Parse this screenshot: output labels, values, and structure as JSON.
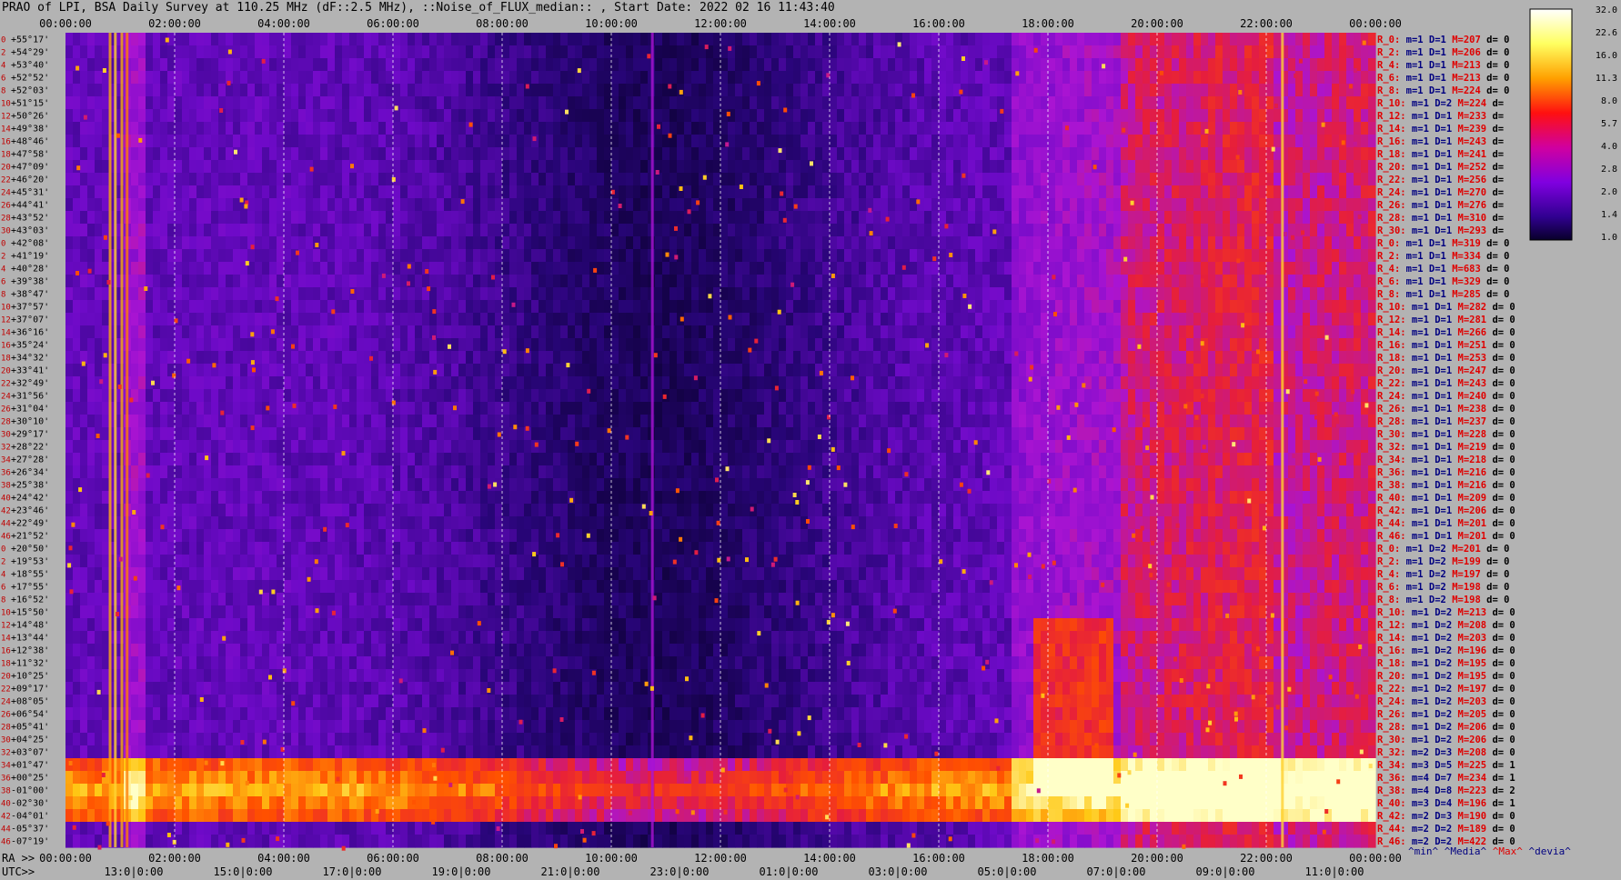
{
  "title": "PRAO of LPI, BSA Daily Survey at 110.25 MHz (dF::2.5 MHz), ::Noise_of_FLUX_median:: , Start Date: 2022 02 16 11:43:40",
  "bottom_labels": {
    "ra": "RA >>",
    "utc": "UTC>>"
  },
  "chart_data": {
    "type": "heatmap",
    "title": "PRAO of LPI, BSA Daily Survey at 110.25 MHz (dF::2.5 MHz), ::Noise_of_FLUX_median:: , Start Date: 2022 02 16 11:43:40",
    "top_axis_ticks": [
      "00:00:00",
      "02:00:00",
      "04:00:00",
      "06:00:00",
      "08:00:00",
      "10:00:00",
      "12:00:00",
      "14:00:00",
      "16:00:00",
      "18:00:00",
      "20:00:00",
      "22:00:00",
      "00:00:00"
    ],
    "ra_axis_ticks": [
      "00:00:00",
      "02:00:00",
      "04:00:00",
      "06:00:00",
      "08:00:00",
      "10:00:00",
      "12:00:00",
      "14:00:00",
      "16:00:00",
      "18:00:00",
      "20:00:00",
      "22:00:00",
      "00:00:00"
    ],
    "utc_axis_ticks": [
      "13:0|0:00",
      "15:0|0:00",
      "17:0|0:00",
      "19:0|0:00",
      "21:0|0:00",
      "23:0|0:00",
      "01:0|0:00",
      "03:0|0:00",
      "05:0|0:00",
      "07:0|0:00",
      "09:0|0:00",
      "11:0|0:00"
    ],
    "dec_labels": [
      "+55°17'",
      "+54°29'",
      "+53°40'",
      "+52°52'",
      "+52°03'",
      "+51°15'",
      "+50°26'",
      "+49°38'",
      "+48°46'",
      "+47°58'",
      "+47°09'",
      "+46°20'",
      "+45°31'",
      "+44°41'",
      "+43°52'",
      "+43°03'",
      "+42°08'",
      "+41°19'",
      "+40°28'",
      "+39°38'",
      "+38°47'",
      "+37°57'",
      "+37°07'",
      "+36°16'",
      "+35°24'",
      "+34°32'",
      "+33°41'",
      "+32°49'",
      "+31°56'",
      "+31°04'",
      "+30°10'",
      "+29°17'",
      "+28°22'",
      "+27°28'",
      "+26°34'",
      "+25°38'",
      "+24°42'",
      "+23°46'",
      "+22°49'",
      "+21°52'",
      "+20°50'",
      "+19°53'",
      "+18°55'",
      "+17°55'",
      "+16°52'",
      "+15°50'",
      "+14°48'",
      "+13°44'",
      "+12°38'",
      "+11°32'",
      "+10°25'",
      "+09°17'",
      "+08°05'",
      "+06°54'",
      "+05°41'",
      "+04°25'",
      "+03°07'",
      "+01°47'",
      "+00°25'",
      "-01°00'",
      "-02°30'",
      "-04°01'",
      "-05°37'",
      "-07°19'"
    ],
    "dec_index": [
      "0",
      "2",
      "4",
      "6",
      "8",
      "10",
      "12",
      "14",
      "16",
      "18",
      "20",
      "22",
      "24",
      "26",
      "28",
      "30",
      "0",
      "2",
      "4",
      "6",
      "8",
      "10",
      "12",
      "14",
      "16",
      "18",
      "20",
      "22",
      "24",
      "26",
      "28",
      "30",
      "32",
      "34",
      "36",
      "38",
      "40",
      "42",
      "44",
      "46",
      "0",
      "2",
      "4",
      "6",
      "8",
      "10",
      "12",
      "14",
      "16",
      "18",
      "20",
      "22",
      "24",
      "26",
      "28",
      "30",
      "32",
      "34",
      "36",
      "38",
      "40",
      "42",
      "44",
      "46"
    ],
    "row_stats": [
      {
        "r": "R_0:",
        "m": "m=1",
        "d": "D=1",
        "M": "M=207",
        "dv": "d= 0"
      },
      {
        "r": "R_2:",
        "m": "m=1",
        "d": "D=1",
        "M": "M=206",
        "dv": "d= 0"
      },
      {
        "r": "R_4:",
        "m": "m=1",
        "d": "D=1",
        "M": "M=213",
        "dv": "d= 0"
      },
      {
        "r": "R_6:",
        "m": "m=1",
        "d": "D=1",
        "M": "M=213",
        "dv": "d= 0"
      },
      {
        "r": "R_8:",
        "m": "m=1",
        "d": "D=1",
        "M": "M=224",
        "dv": "d= 0"
      },
      {
        "r": "R_10:",
        "m": "m=1",
        "d": "D=2",
        "M": "M=224",
        "dv": "d="
      },
      {
        "r": "R_12:",
        "m": "m=1",
        "d": "D=1",
        "M": "M=233",
        "dv": "d="
      },
      {
        "r": "R_14:",
        "m": "m=1",
        "d": "D=1",
        "M": "M=239",
        "dv": "d="
      },
      {
        "r": "R_16:",
        "m": "m=1",
        "d": "D=1",
        "M": "M=243",
        "dv": "d="
      },
      {
        "r": "R_18:",
        "m": "m=1",
        "d": "D=1",
        "M": "M=241",
        "dv": "d="
      },
      {
        "r": "R_20:",
        "m": "m=1",
        "d": "D=1",
        "M": "M=252",
        "dv": "d="
      },
      {
        "r": "R_22:",
        "m": "m=1",
        "d": "D=1",
        "M": "M=256",
        "dv": "d="
      },
      {
        "r": "R_24:",
        "m": "m=1",
        "d": "D=1",
        "M": "M=270",
        "dv": "d="
      },
      {
        "r": "R_26:",
        "m": "m=1",
        "d": "D=1",
        "M": "M=276",
        "dv": "d="
      },
      {
        "r": "R_28:",
        "m": "m=1",
        "d": "D=1",
        "M": "M=310",
        "dv": "d="
      },
      {
        "r": "R_30:",
        "m": "m=1",
        "d": "D=1",
        "M": "M=293",
        "dv": "d="
      },
      {
        "r": "R_0:",
        "m": "m=1",
        "d": "D=1",
        "M": "M=319",
        "dv": "d= 0"
      },
      {
        "r": "R_2:",
        "m": "m=1",
        "d": "D=1",
        "M": "M=334",
        "dv": "d= 0"
      },
      {
        "r": "R_4:",
        "m": "m=1",
        "d": "D=1",
        "M": "M=683",
        "dv": "d= 0"
      },
      {
        "r": "R_6:",
        "m": "m=1",
        "d": "D=1",
        "M": "M=329",
        "dv": "d= 0"
      },
      {
        "r": "R_8:",
        "m": "m=1",
        "d": "D=1",
        "M": "M=285",
        "dv": "d= 0"
      },
      {
        "r": "R_10:",
        "m": "m=1",
        "d": "D=1",
        "M": "M=282",
        "dv": "d= 0"
      },
      {
        "r": "R_12:",
        "m": "m=1",
        "d": "D=1",
        "M": "M=281",
        "dv": "d= 0"
      },
      {
        "r": "R_14:",
        "m": "m=1",
        "d": "D=1",
        "M": "M=266",
        "dv": "d= 0"
      },
      {
        "r": "R_16:",
        "m": "m=1",
        "d": "D=1",
        "M": "M=251",
        "dv": "d= 0"
      },
      {
        "r": "R_18:",
        "m": "m=1",
        "d": "D=1",
        "M": "M=253",
        "dv": "d= 0"
      },
      {
        "r": "R_20:",
        "m": "m=1",
        "d": "D=1",
        "M": "M=247",
        "dv": "d= 0"
      },
      {
        "r": "R_22:",
        "m": "m=1",
        "d": "D=1",
        "M": "M=243",
        "dv": "d= 0"
      },
      {
        "r": "R_24:",
        "m": "m=1",
        "d": "D=1",
        "M": "M=240",
        "dv": "d= 0"
      },
      {
        "r": "R_26:",
        "m": "m=1",
        "d": "D=1",
        "M": "M=238",
        "dv": "d= 0"
      },
      {
        "r": "R_28:",
        "m": "m=1",
        "d": "D=1",
        "M": "M=237",
        "dv": "d= 0"
      },
      {
        "r": "R_30:",
        "m": "m=1",
        "d": "D=1",
        "M": "M=228",
        "dv": "d= 0"
      },
      {
        "r": "R_32:",
        "m": "m=1",
        "d": "D=1",
        "M": "M=219",
        "dv": "d= 0"
      },
      {
        "r": "R_34:",
        "m": "m=1",
        "d": "D=1",
        "M": "M=218",
        "dv": "d= 0"
      },
      {
        "r": "R_36:",
        "m": "m=1",
        "d": "D=1",
        "M": "M=216",
        "dv": "d= 0"
      },
      {
        "r": "R_38:",
        "m": "m=1",
        "d": "D=1",
        "M": "M=216",
        "dv": "d= 0"
      },
      {
        "r": "R_40:",
        "m": "m=1",
        "d": "D=1",
        "M": "M=209",
        "dv": "d= 0"
      },
      {
        "r": "R_42:",
        "m": "m=1",
        "d": "D=1",
        "M": "M=206",
        "dv": "d= 0"
      },
      {
        "r": "R_44:",
        "m": "m=1",
        "d": "D=1",
        "M": "M=201",
        "dv": "d= 0"
      },
      {
        "r": "R_46:",
        "m": "m=1",
        "d": "D=1",
        "M": "M=201",
        "dv": "d= 0"
      },
      {
        "r": "R_0:",
        "m": "m=1",
        "d": "D=2",
        "M": "M=201",
        "dv": "d= 0"
      },
      {
        "r": "R_2:",
        "m": "m=1",
        "d": "D=2",
        "M": "M=199",
        "dv": "d= 0"
      },
      {
        "r": "R_4:",
        "m": "m=1",
        "d": "D=2",
        "M": "M=197",
        "dv": "d= 0"
      },
      {
        "r": "R_6:",
        "m": "m=1",
        "d": "D=2",
        "M": "M=198",
        "dv": "d= 0"
      },
      {
        "r": "R_8:",
        "m": "m=1",
        "d": "D=2",
        "M": "M=198",
        "dv": "d= 0"
      },
      {
        "r": "R_10:",
        "m": "m=1",
        "d": "D=2",
        "M": "M=213",
        "dv": "d= 0"
      },
      {
        "r": "R_12:",
        "m": "m=1",
        "d": "D=2",
        "M": "M=208",
        "dv": "d= 0"
      },
      {
        "r": "R_14:",
        "m": "m=1",
        "d": "D=2",
        "M": "M=203",
        "dv": "d= 0"
      },
      {
        "r": "R_16:",
        "m": "m=1",
        "d": "D=2",
        "M": "M=196",
        "dv": "d= 0"
      },
      {
        "r": "R_18:",
        "m": "m=1",
        "d": "D=2",
        "M": "M=195",
        "dv": "d= 0"
      },
      {
        "r": "R_20:",
        "m": "m=1",
        "d": "D=2",
        "M": "M=195",
        "dv": "d= 0"
      },
      {
        "r": "R_22:",
        "m": "m=1",
        "d": "D=2",
        "M": "M=197",
        "dv": "d= 0"
      },
      {
        "r": "R_24:",
        "m": "m=1",
        "d": "D=2",
        "M": "M=203",
        "dv": "d= 0"
      },
      {
        "r": "R_26:",
        "m": "m=1",
        "d": "D=2",
        "M": "M=205",
        "dv": "d= 0"
      },
      {
        "r": "R_28:",
        "m": "m=1",
        "d": "D=2",
        "M": "M=206",
        "dv": "d= 0"
      },
      {
        "r": "R_30:",
        "m": "m=1",
        "d": "D=2",
        "M": "M=206",
        "dv": "d= 0"
      },
      {
        "r": "R_32:",
        "m": "m=2",
        "d": "D=3",
        "M": "M=208",
        "dv": "d= 0"
      },
      {
        "r": "R_34:",
        "m": "m=3",
        "d": "D=5",
        "M": "M=225",
        "dv": "d= 1"
      },
      {
        "r": "R_36:",
        "m": "m=4",
        "d": "D=7",
        "M": "M=234",
        "dv": "d= 1"
      },
      {
        "r": "R_38:",
        "m": "m=4",
        "d": "D=8",
        "M": "M=223",
        "dv": "d= 2"
      },
      {
        "r": "R_40:",
        "m": "m=3",
        "d": "D=4",
        "M": "M=196",
        "dv": "d= 1"
      },
      {
        "r": "R_42:",
        "m": "m=2",
        "d": "D=3",
        "M": "M=190",
        "dv": "d= 0"
      },
      {
        "r": "R_44:",
        "m": "m=2",
        "d": "D=2",
        "M": "M=189",
        "dv": "d= 0"
      },
      {
        "r": "R_46:",
        "m": "m=2",
        "d": "D=2",
        "M": "M=422",
        "dv": "d= 0"
      }
    ],
    "colorbar_ticks": [
      "32.0",
      "22.6",
      "16.0",
      "11.3",
      "8.0",
      "5.7",
      "4.0",
      "2.8",
      "2.0",
      "1.4",
      "1.0"
    ],
    "legend": [
      {
        "text": "^min^",
        "color": "#000080"
      },
      {
        "text": "^Media^",
        "color": "#000080"
      },
      {
        "text": "^Max^",
        "color": "#e00000"
      },
      {
        "text": "^devia^",
        "color": "#000080"
      }
    ],
    "colors": {
      "background": "#b3b3b3",
      "row_label": "#e00000",
      "row_value": "#000080",
      "low": "#0a0030",
      "mid": "#7a00d0",
      "high": "#ff3000",
      "peak": "#ffffc0"
    }
  }
}
